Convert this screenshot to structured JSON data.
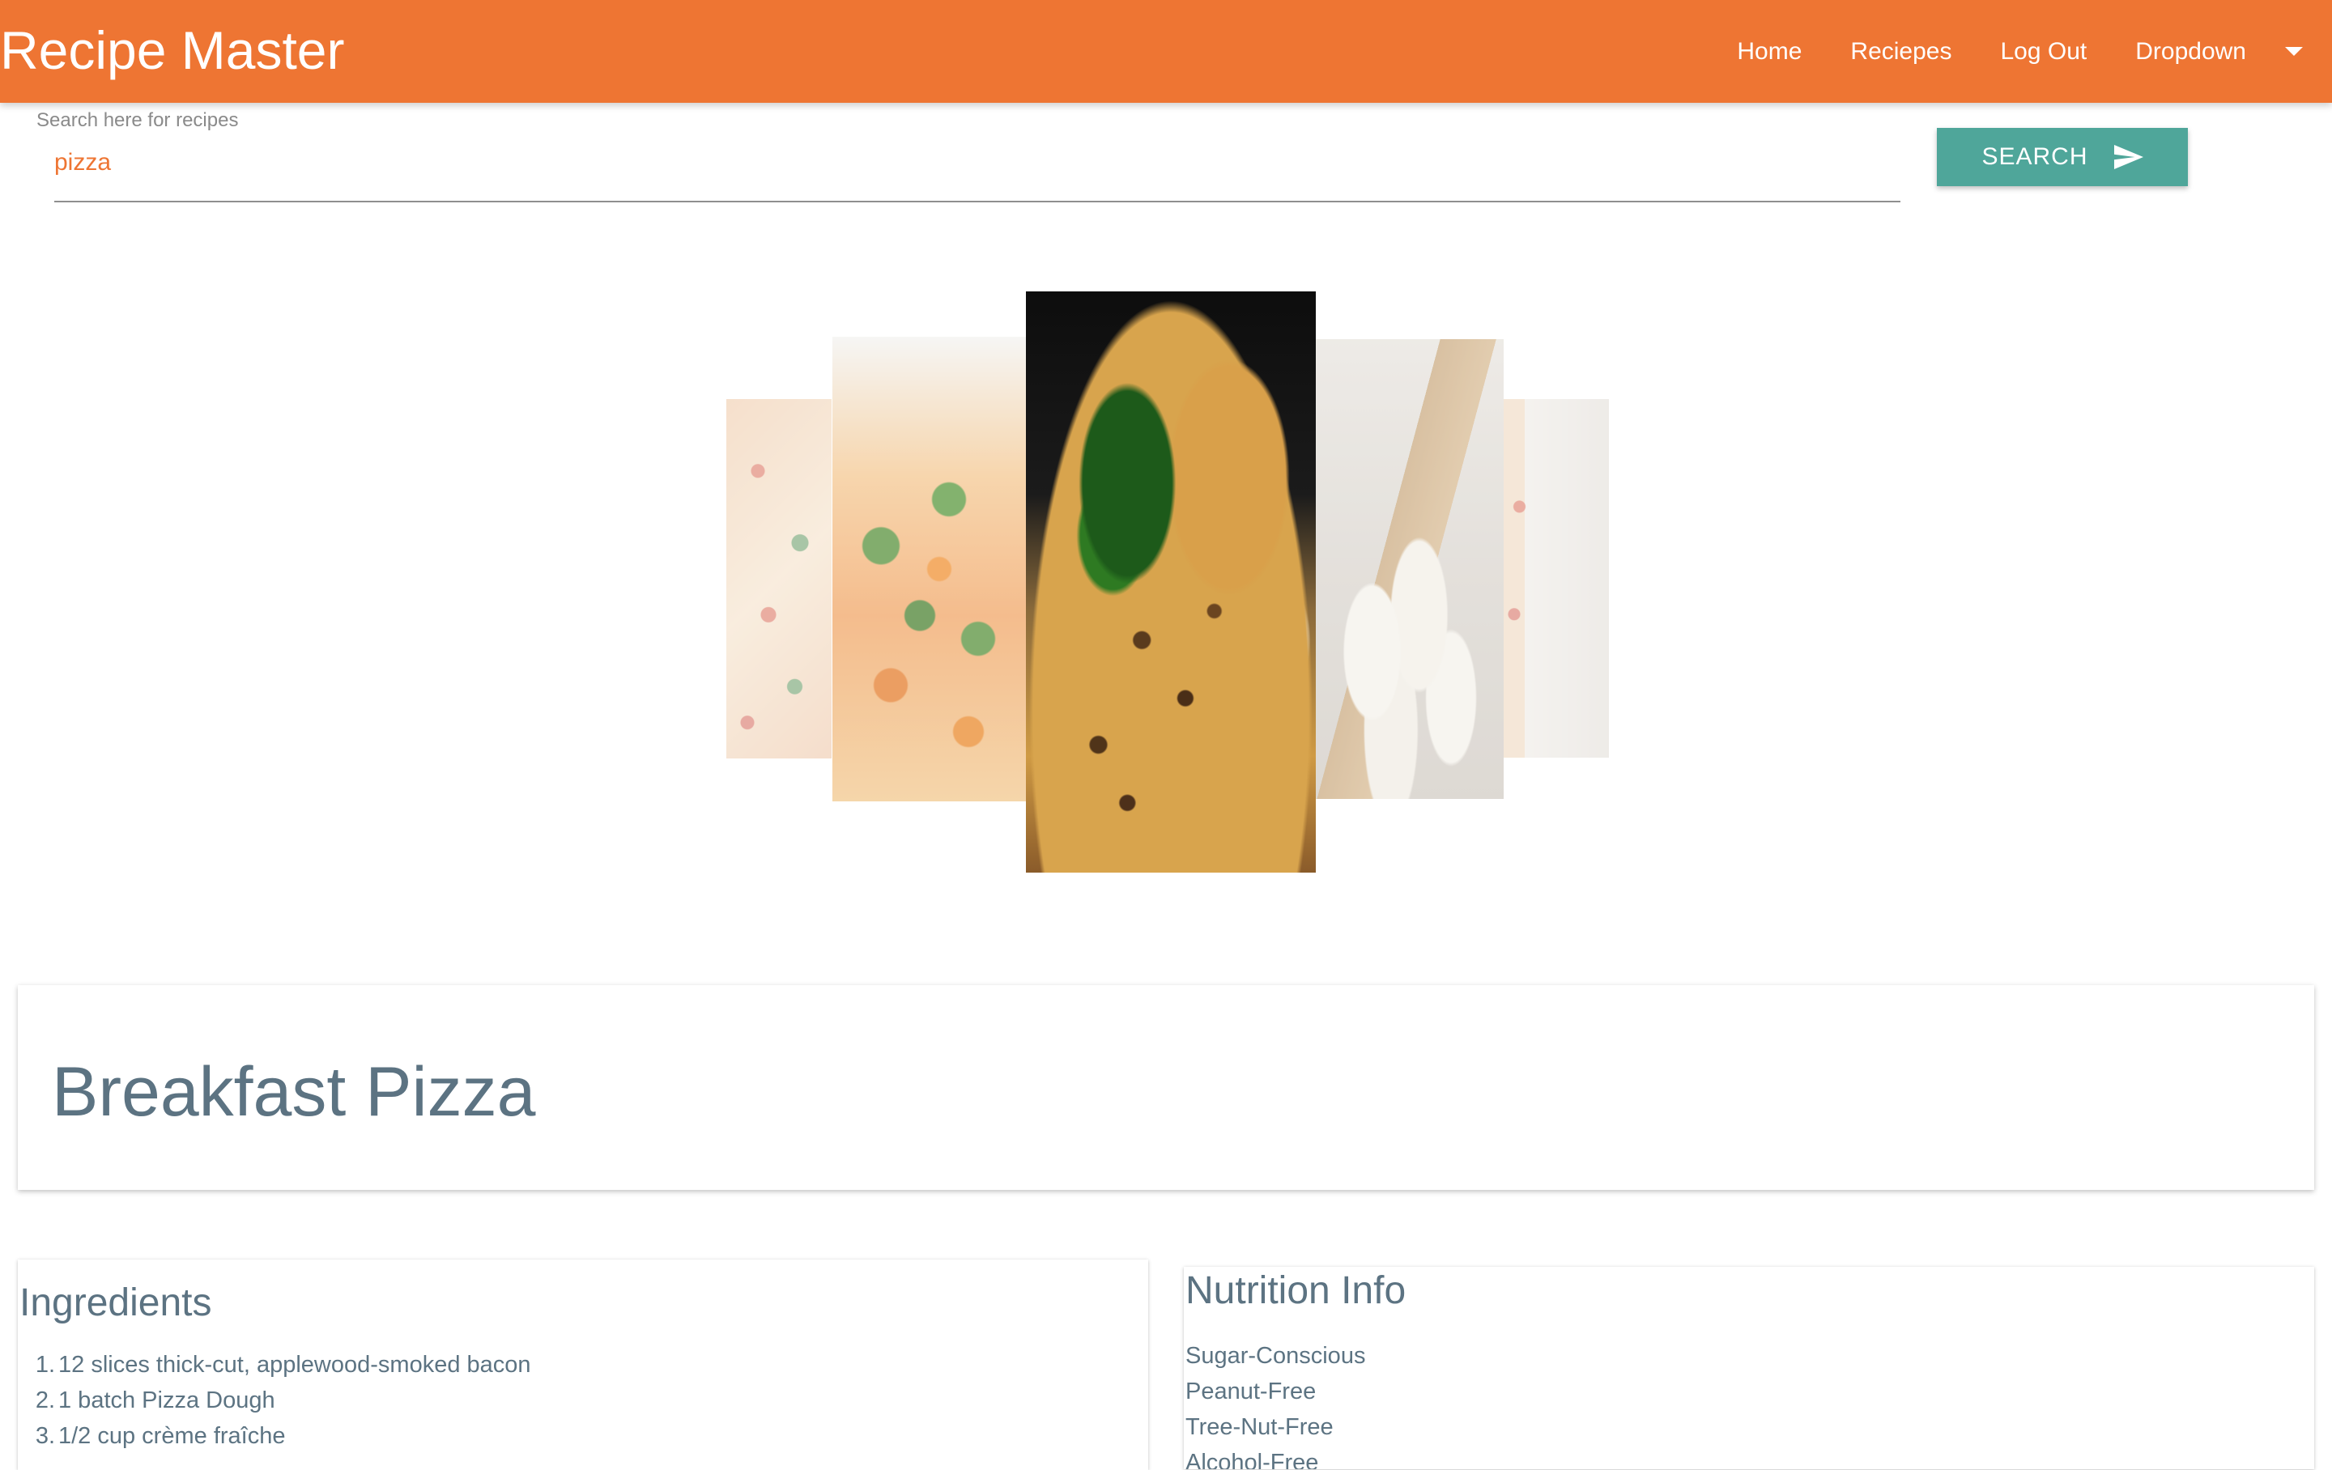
{
  "navbar": {
    "brand": "Recipe Master",
    "links": [
      "Home",
      "Reciepes",
      "Log Out",
      "Dropdown"
    ],
    "bg_color": "#ee7533"
  },
  "search": {
    "label": "Search here for recipes",
    "value": "pizza",
    "button_label": "SEARCH",
    "button_color": "#4fa69a"
  },
  "carousel": {
    "slides": [
      "pizza-top-view",
      "vegetable-pizza",
      "sliced-pizza",
      "pizza-dough-balls",
      "pizza-on-board"
    ],
    "active_index": 2
  },
  "recipe": {
    "title": "Breakfast Pizza"
  },
  "ingredients": {
    "heading": "Ingredients",
    "items": [
      {
        "num": "1.",
        "text": "12 slices thick-cut, applewood-smoked bacon"
      },
      {
        "num": "2.",
        "text": "1 batch Pizza Dough"
      },
      {
        "num": "3.",
        "text": "1/2 cup crème fraîche"
      }
    ]
  },
  "nutrition": {
    "heading": "Nutrition Info",
    "labels": [
      "Sugar-Conscious",
      "Peanut-Free",
      "Tree-Nut-Free",
      "Alcohol-Free"
    ]
  },
  "colors": {
    "accent": "#ee7533",
    "text": "#5c7382",
    "button": "#4fa69a"
  }
}
